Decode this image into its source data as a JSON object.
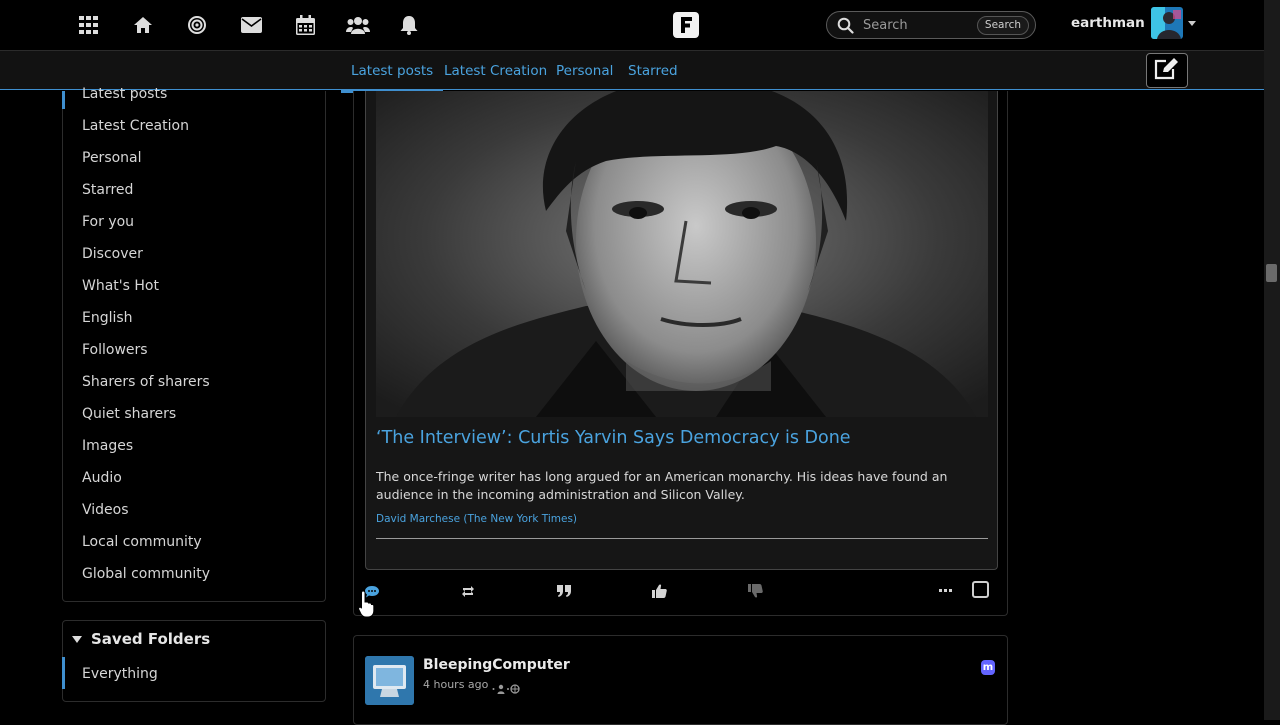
{
  "topbar": {
    "icons": [
      "apps-grid-icon",
      "home-icon",
      "target-icon",
      "mail-icon",
      "calendar-icon",
      "group-icon",
      "bell-icon"
    ],
    "brand_icon": "friendica-logo-icon",
    "search": {
      "placeholder": "Search",
      "button_label": "Search"
    },
    "username": "earthman"
  },
  "subnav": {
    "tabs": [
      {
        "label": "Latest posts",
        "active": true
      },
      {
        "label": "Latest Creation",
        "active": false
      },
      {
        "label": "Personal",
        "active": false
      },
      {
        "label": "Starred",
        "active": false
      }
    ],
    "compose_icon": "pencil-square-icon"
  },
  "sidebar": {
    "items": [
      {
        "label": "Latest posts",
        "active": true
      },
      {
        "label": "Latest Creation"
      },
      {
        "label": "Personal"
      },
      {
        "label": "Starred"
      },
      {
        "label": "For you"
      },
      {
        "label": "Discover"
      },
      {
        "label": "What's Hot"
      },
      {
        "label": "English"
      },
      {
        "label": "Followers"
      },
      {
        "label": "Sharers of sharers"
      },
      {
        "label": "Quiet sharers"
      },
      {
        "label": "Images"
      },
      {
        "label": "Audio"
      },
      {
        "label": "Videos"
      },
      {
        "label": "Local community"
      },
      {
        "label": "Global community"
      }
    ],
    "saved_folders": {
      "title": "Saved Folders",
      "items": [
        "Everything"
      ]
    }
  },
  "post": {
    "link_card": {
      "title": "‘The Interview’: Curtis Yarvin Says Democracy is Done",
      "description": "The once-fringe writer has long argued for an American monarchy. His ideas have found an audience in the incoming administration and Silicon Valley.",
      "author": "David Marchese (The New York Times)"
    },
    "actions": [
      "comment-icon",
      "reshare-icon",
      "quote-icon",
      "like-icon",
      "dislike-icon",
      "more-icon"
    ]
  },
  "next_post": {
    "author": "BleepingComputer",
    "time": "4 hours ago",
    "network_icon": "mastodon-icon",
    "network_letter": "m"
  },
  "colors": {
    "accent": "#4aa3df",
    "background": "#000000",
    "panel_border": "#2c2c2c"
  }
}
